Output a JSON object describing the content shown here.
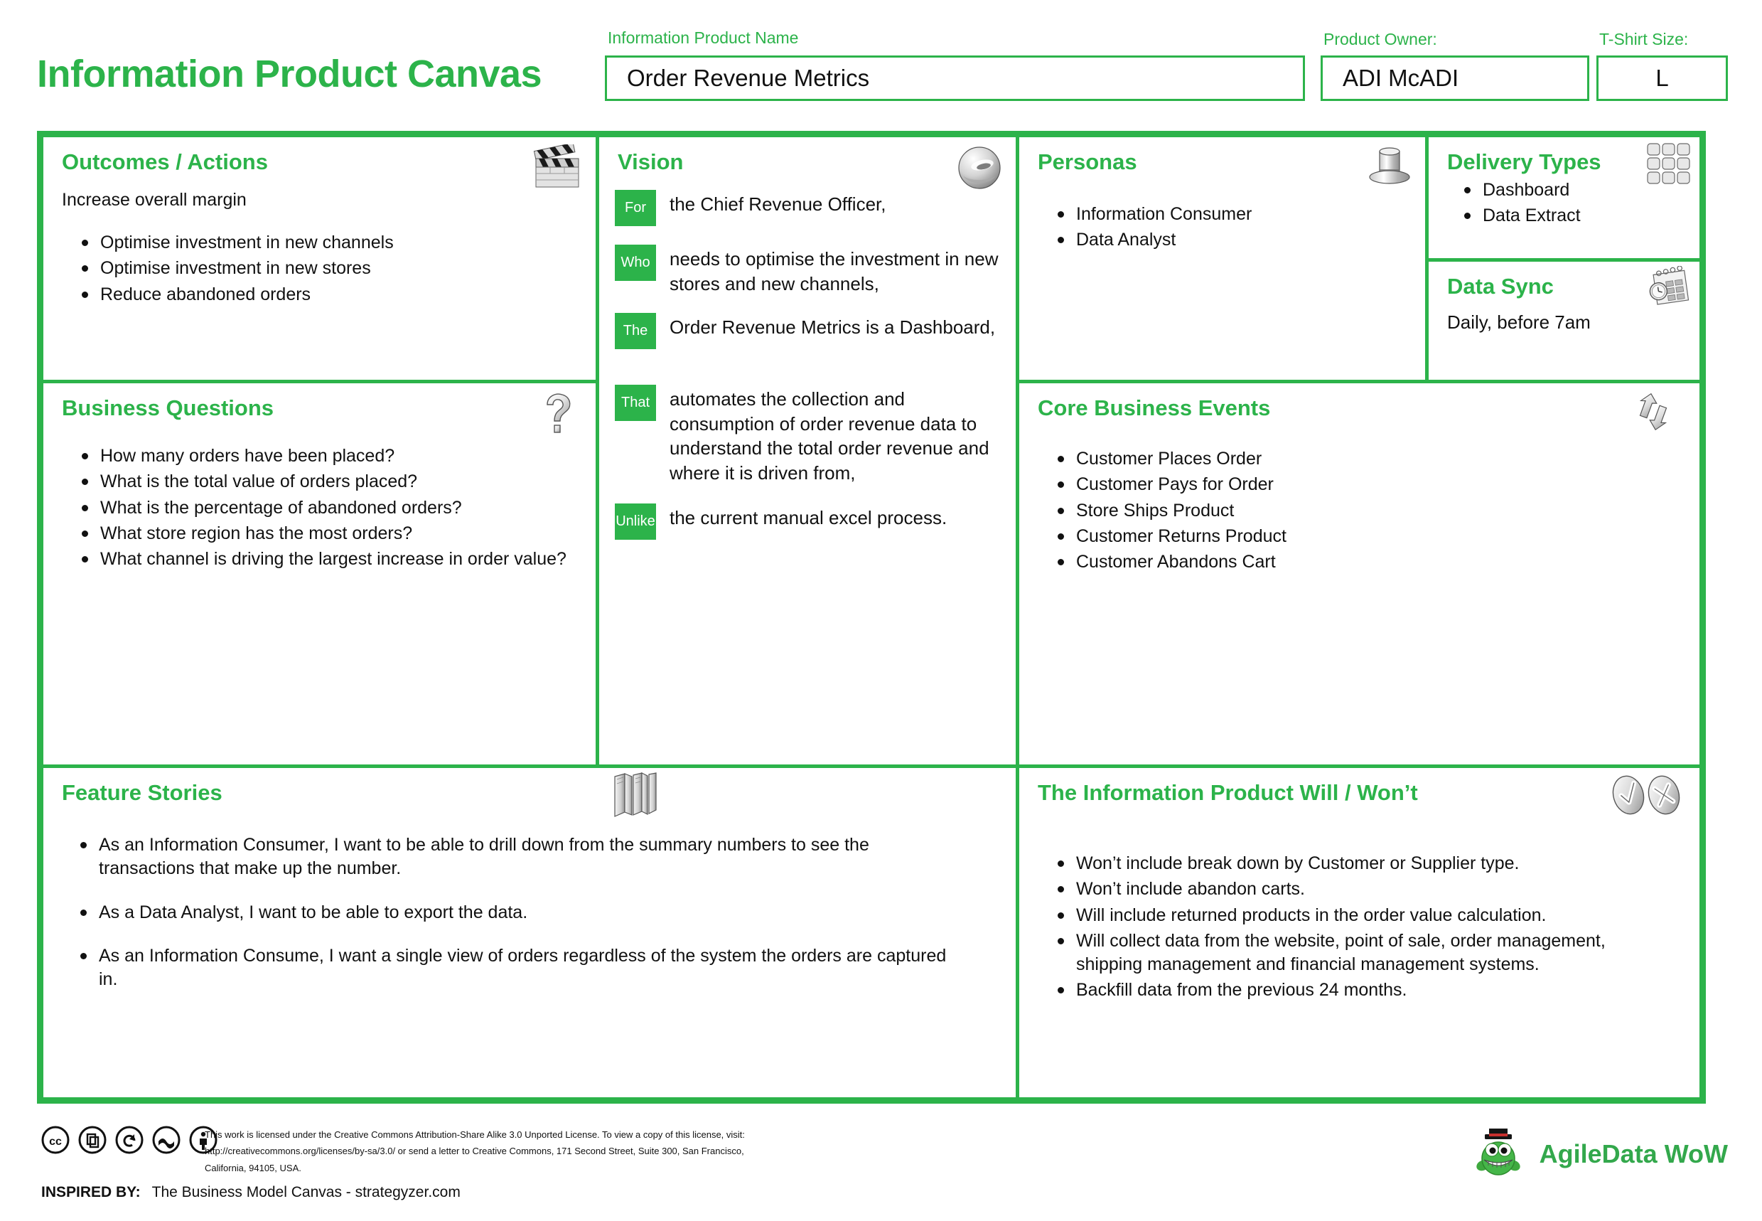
{
  "header": {
    "app_title": "Information Product Canvas",
    "product_name_label": "Information Product Name",
    "product_name_value": "Order Revenue Metrics",
    "product_owner_label": "Product Owner:",
    "product_owner_value": "ADI McADI",
    "tshirt_size_label": "T-Shirt Size:",
    "tshirt_size_value": "L"
  },
  "accent_color": "#2CB34A",
  "outcomes": {
    "title": "Outcomes / Actions",
    "lead": "Increase overall margin",
    "items": [
      "Optimise investment in new channels",
      "Optimise investment in new stores",
      "Reduce abandoned orders"
    ]
  },
  "business_questions": {
    "title": "Business Questions",
    "items": [
      "How many orders have been placed?",
      "What is the total value of orders placed?",
      "What is the percentage of abandoned orders?",
      "What store region has the most orders?",
      "What channel is driving the largest increase in order value?"
    ]
  },
  "vision": {
    "title": "Vision",
    "rows": [
      {
        "tag": "For",
        "text": "the Chief Revenue Officer,"
      },
      {
        "tag": "Who",
        "text": "needs to optimise the investment in new stores and new channels,"
      },
      {
        "tag": "The",
        "text": "Order Revenue Metrics is a Dashboard,"
      },
      {
        "tag": "That",
        "text": "automates the collection and consumption of order revenue data to understand the total order revenue and where it is driven from,"
      },
      {
        "tag": "Unlike",
        "text": "the current manual excel process."
      }
    ]
  },
  "personas": {
    "title": "Personas",
    "items": [
      "Information Consumer",
      "Data Analyst"
    ]
  },
  "delivery_types": {
    "title": "Delivery Types",
    "items": [
      "Dashboard",
      "Data Extract"
    ]
  },
  "data_sync": {
    "title": "Data Sync",
    "value": "Daily, before 7am"
  },
  "core_business_events": {
    "title": "Core Business Events",
    "items": [
      "Customer Places Order",
      "Customer Pays for Order",
      "Store Ships Product",
      "Customer Returns Product",
      "Customer Abandons Cart"
    ]
  },
  "feature_stories": {
    "title": "Feature Stories",
    "items": [
      "As an Information Consumer, I want to be able to drill down from the summary numbers to see the transactions that make up the number.",
      "As a Data Analyst, I want to be able to export the data.",
      "As an Information Consume, I want a single view of orders regardless of the system the orders are captured in."
    ]
  },
  "will_wont": {
    "title": "The Information Product Will / Won’t",
    "items": [
      "Won’t include break down by Customer or Supplier type.",
      "Won’t include abandon carts.",
      "Will include returned products in the order value calculation.",
      "Will collect data from the website, point of sale, order management, shipping management and financial management systems.",
      "Backfill data from the previous 24 months."
    ]
  },
  "footer": {
    "license_line1": "This work is licensed under the Creative Commons Attribution-Share Alike 3.0 Unported License. To view a copy of this license, visit:",
    "license_line2": "http://creativecommons.org/licenses/by-sa/3.0/ or send a letter to Creative Commons, 171 Second Street, Suite 300, San Francisco, California, 94105, USA.",
    "inspired_label": "INSPIRED BY:",
    "inspired_value": "The Business Model Canvas - strategyzer.com",
    "brand_name": "AgileData WoW"
  }
}
